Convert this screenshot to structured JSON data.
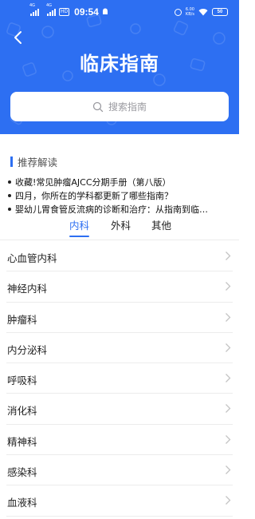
{
  "status_bar": {
    "signal_1_label": "4G",
    "signal_2_label": "4G",
    "hd_label": "HD",
    "time": "09:54",
    "net_speed_value": "6.00",
    "net_speed_unit": "KB/s",
    "battery": "50"
  },
  "header": {
    "title": "临床指南",
    "bg_color": "#2d6ff2"
  },
  "search": {
    "placeholder": "搜索指南"
  },
  "recommend": {
    "label": "推荐解读",
    "items": [
      "收藏!常见肿瘤AJCC分期手册（第八版）",
      "四月，你所在的学科都更新了哪些指南？",
      "婴幼儿胃食管反流病的诊断和治疗：从指南到临…"
    ]
  },
  "tabs": {
    "items": [
      "内科",
      "外科",
      "其他"
    ],
    "active_index": 0
  },
  "departments": [
    "心血管内科",
    "神经内科",
    "肿瘤科",
    "内分泌科",
    "呼吸科",
    "消化科",
    "精神科",
    "感染科",
    "血液科"
  ]
}
